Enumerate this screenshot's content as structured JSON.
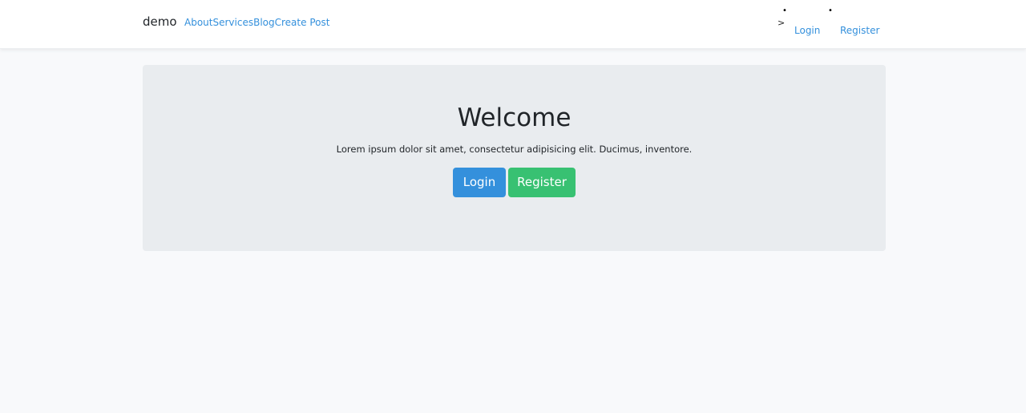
{
  "navbar": {
    "brand": "demo",
    "links": [
      "About",
      "Services",
      "Blog",
      "Create Post"
    ],
    "arrow": ">",
    "right_links": [
      "Login",
      "Register"
    ]
  },
  "jumbotron": {
    "title": "Welcome",
    "text": "Lorem ipsum dolor sit amet, consectetur adipisicing elit. Ducimus, inventore.",
    "login_label": "Login",
    "register_label": "Register"
  },
  "colors": {
    "link": "#3490dc",
    "primary": "#3490dc",
    "success": "#38c172",
    "jumbotron_bg": "#e9ecef",
    "page_bg": "#f8f9fb"
  }
}
